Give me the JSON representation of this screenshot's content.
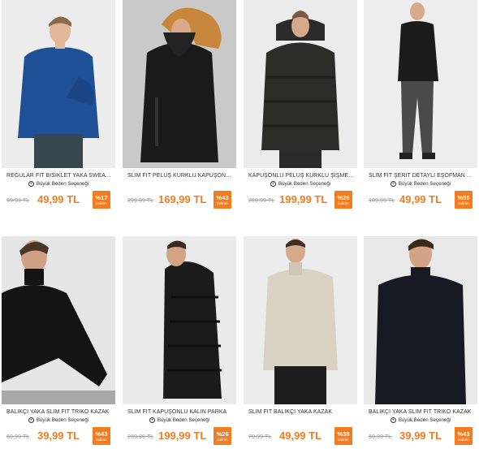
{
  "size_option_label": "Büyük Beden Seçeneği",
  "discount_label": "indirim",
  "products": [
    {
      "name": "REGULAR FİT BİSİKLET YAKA SWEATSHIRT",
      "old_price": "59,99 TL",
      "price": "49,99 TL",
      "discount": "%17",
      "has_size_option": true
    },
    {
      "name": "SLİM FİT PELUŞ KÜRKLÜ KAPÜŞONLU MONT",
      "old_price": "299,99 TL",
      "price": "169,99 TL",
      "discount": "%43",
      "has_size_option": false
    },
    {
      "name": "KAPÜŞONLU PELUŞ KÜRKLÜ ŞİŞME KABAN",
      "old_price": "269,99 TL",
      "price": "199,99 TL",
      "discount": "%26",
      "has_size_option": true
    },
    {
      "name": "SLİM FİT ŞERİT DETAYLI EŞOFMAN ALTI",
      "old_price": "109,99 TL",
      "price": "49,99 TL",
      "discount": "%55",
      "has_size_option": true
    },
    {
      "name": "BALIKÇI YAKA SLİM FİT TRİKO KAZAK",
      "old_price": "69,99 TL",
      "price": "39,99 TL",
      "discount": "%43",
      "has_size_option": true
    },
    {
      "name": "SLİM FİT KAPÜŞONLU KALIN PARKA",
      "old_price": "269,99 TL",
      "price": "199,99 TL",
      "discount": "%26",
      "has_size_option": true
    },
    {
      "name": "SLİM FİT BALIKÇI YAKA KAZAK",
      "old_price": "79,99 TL",
      "price": "49,99 TL",
      "discount": "%38",
      "has_size_option": false
    },
    {
      "name": "BALIKÇI YAKA SLİM FİT TRİKO KAZAK",
      "old_price": "69,99 TL",
      "price": "39,99 TL",
      "discount": "%43",
      "has_size_option": true
    }
  ],
  "colors": {
    "accent": "#f47c20",
    "old_price": "#9b9b9b",
    "text": "#333333"
  }
}
